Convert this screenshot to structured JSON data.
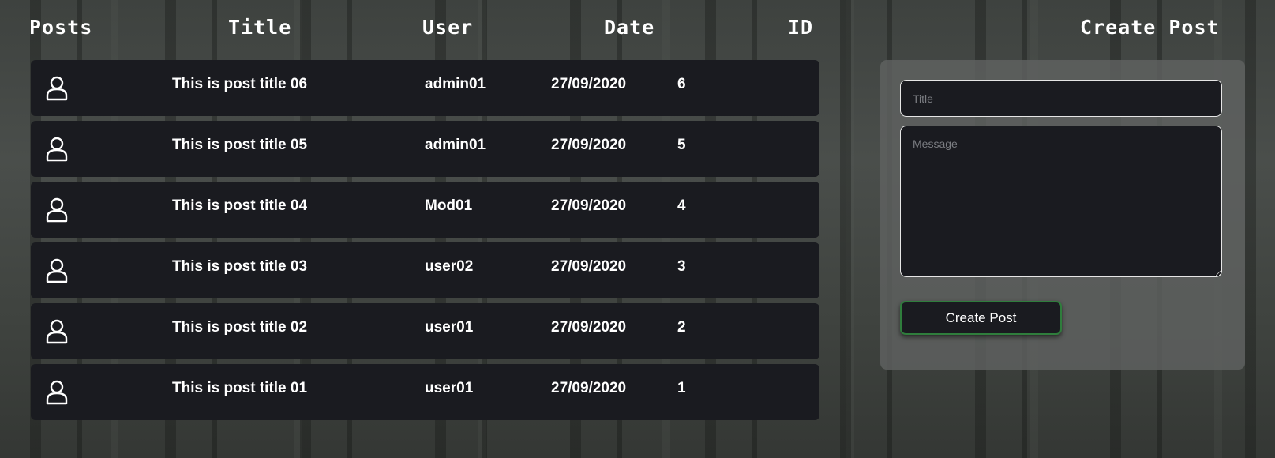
{
  "headers": {
    "posts": "Posts",
    "title": "Title",
    "user": "User",
    "date": "Date",
    "id": "ID",
    "create_post": "Create Post"
  },
  "posts": [
    {
      "icon": "user-icon",
      "title": "This is post title 06",
      "user": "admin01",
      "date": "27/09/2020",
      "id": "6"
    },
    {
      "icon": "user-icon",
      "title": "This is post title 05",
      "user": "admin01",
      "date": "27/09/2020",
      "id": "5"
    },
    {
      "icon": "user-icon",
      "title": "This is post title 04",
      "user": "Mod01",
      "date": "27/09/2020",
      "id": "4"
    },
    {
      "icon": "user-icon",
      "title": "This is post title 03",
      "user": "user02",
      "date": "27/09/2020",
      "id": "3"
    },
    {
      "icon": "user-icon",
      "title": "This is post title 02",
      "user": "user01",
      "date": "27/09/2020",
      "id": "2"
    },
    {
      "icon": "user-icon",
      "title": "This is post title 01",
      "user": "user01",
      "date": "27/09/2020",
      "id": "1"
    }
  ],
  "create_form": {
    "title_placeholder": "Title",
    "title_value": "",
    "message_placeholder": "Message",
    "message_value": "",
    "button_label": "Create Post"
  },
  "colors": {
    "row_background": "#1a1b20",
    "panel_background": "#5f6260",
    "button_border": "#2f7d3c",
    "text": "#ffffff"
  }
}
